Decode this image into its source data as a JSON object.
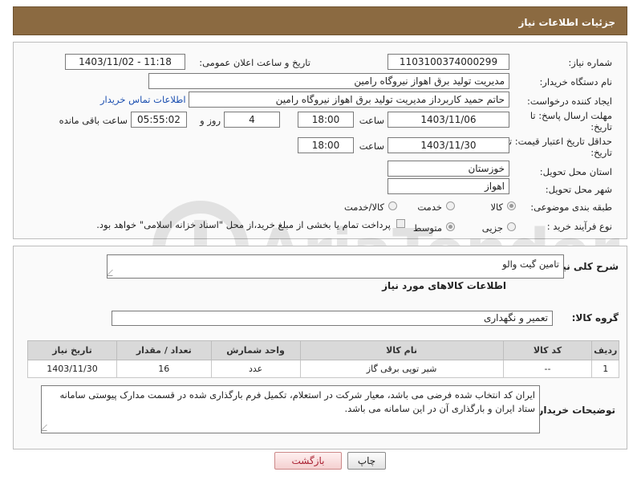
{
  "header": {
    "title": "جزئیات اطلاعات نیاز"
  },
  "form": {
    "need_number": {
      "label": "شماره نیاز:",
      "value": "1103100374000299"
    },
    "announce_datetime": {
      "label": "تاریخ و ساعت اعلان عمومی:",
      "value": "1403/11/02 - 11:18"
    },
    "buyer_org": {
      "label": "نام دستگاه خریدار:",
      "value": "مدیریت تولید برق اهواز نیروگاه رامین"
    },
    "requester": {
      "label": "ایجاد کننده درخواست:",
      "value": "حاتم حمید کاربرداز مدیریت تولید برق اهواز نیروگاه رامین",
      "contact_link": "اطلاعات تماس خریدار"
    },
    "reply_deadline": {
      "label_line1": "مهلت ارسال پاسخ: تا",
      "label_line2": "تاریخ:",
      "date": "1403/11/06",
      "time_label": "ساعت",
      "time": "18:00",
      "days": "4",
      "days_label": "روز و",
      "remaining": "05:55:02",
      "remaining_label": "ساعت باقی مانده"
    },
    "price_validity": {
      "label_line1": "حداقل تاریخ اعتبار قیمت: تا",
      "label_line2": "تاریخ:",
      "date": "1403/11/30",
      "time_label": "ساعت",
      "time": "18:00"
    },
    "province": {
      "label": "استان محل تحویل:",
      "value": "خوزستان"
    },
    "city": {
      "label": "شهر محل تحویل:",
      "value": "اهواز"
    },
    "category": {
      "label": "طبقه بندی موضوعی:",
      "options": [
        "کالا",
        "خدمت",
        "کالا/خدمت"
      ],
      "selected": "کالا"
    },
    "process_type": {
      "label": "نوع فرآیند خرید :",
      "options": [
        "جزیی",
        "متوسط"
      ],
      "selected": "متوسط",
      "payment_note": "پرداخت تمام یا بخشی از مبلغ خرید،از محل \"اسناد خزانه اسلامی\" خواهد بود."
    }
  },
  "details": {
    "general_desc_label": "شرح کلی نیاز:",
    "general_desc_value": "تامین گیت والو",
    "goods_info_title": "اطلاعات کالاهای مورد نیاز",
    "goods_group_label": "گروه کالا:",
    "goods_group_value": "تعمیر و نگهداری",
    "table": {
      "headers": [
        "ردیف",
        "کد کالا",
        "نام کالا",
        "واحد شمارش",
        "تعداد / مقدار",
        "تاریخ نیاز"
      ],
      "rows": [
        [
          "1",
          "--",
          "شیر توپی برقی گاز",
          "عدد",
          "16",
          "1403/11/30"
        ]
      ]
    },
    "buyer_notes_label": "توضیحات خریدار:",
    "buyer_notes_value": "ایران کد انتخاب شده فرضی می باشد، معیار شرکت در استعلام، تکمیل فرم بارگذاری شده در قسمت مدارک پیوستی سامانه ستاد ایران و بارگذاری آن در این سامانه می باشد."
  },
  "buttons": {
    "print": "چاپ",
    "back": "بازگشت"
  },
  "watermark": {
    "text": "AriaTender.neT"
  },
  "colors": {
    "header_bg": "#8b6a41",
    "link": "#1b4fb0",
    "table_header_bg": "#d9d9d9"
  }
}
